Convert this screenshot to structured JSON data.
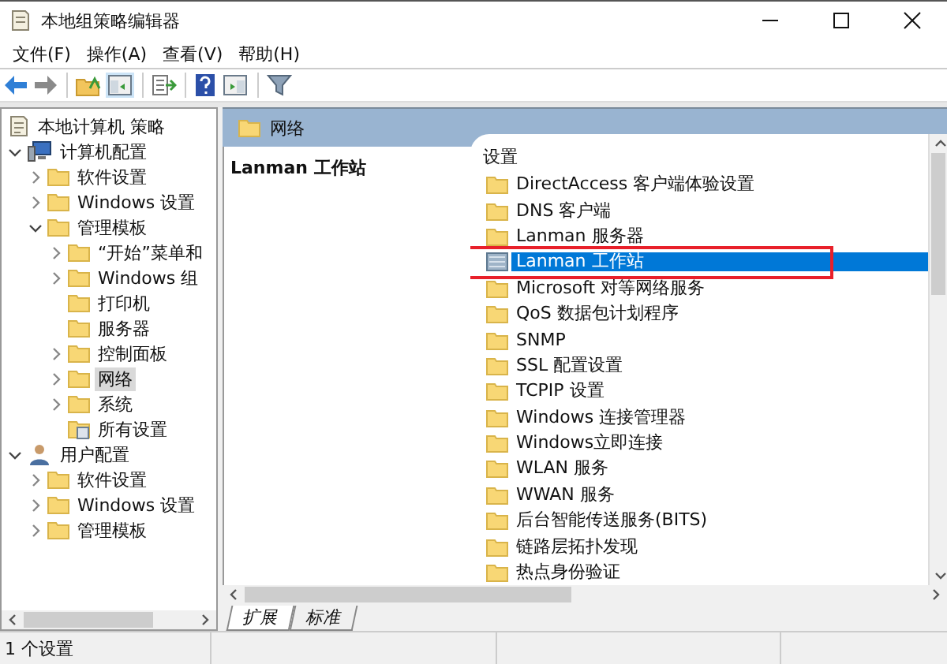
{
  "window": {
    "title": "本地组策略编辑器"
  },
  "menu": [
    "文件(F)",
    "操作(A)",
    "查看(V)",
    "帮助(H)"
  ],
  "tree": [
    {
      "label": "本地计算机 策略",
      "kind": "policy",
      "selected": false,
      "children": [
        {
          "label": "计算机配置",
          "kind": "computer",
          "selected": false,
          "expanded": true,
          "children": [
            {
              "label": "软件设置",
              "kind": "folder",
              "selected": false,
              "expanded": false
            },
            {
              "label": "Windows 设置",
              "kind": "folder",
              "selected": false,
              "expanded": false
            },
            {
              "label": "管理模板",
              "kind": "folder",
              "selected": false,
              "expanded": true,
              "children": [
                {
                  "label": "“开始”菜单和",
                  "kind": "folder",
                  "selected": false,
                  "expanded": false
                },
                {
                  "label": "Windows 组",
                  "kind": "folder",
                  "selected": false,
                  "expanded": false
                },
                {
                  "label": "打印机",
                  "kind": "folder",
                  "selected": false
                },
                {
                  "label": "服务器",
                  "kind": "folder",
                  "selected": false
                },
                {
                  "label": "控制面板",
                  "kind": "folder",
                  "selected": false,
                  "expanded": false
                },
                {
                  "label": "网络",
                  "kind": "folder",
                  "selected": true,
                  "expanded": false
                },
                {
                  "label": "系统",
                  "kind": "folder",
                  "selected": false,
                  "expanded": false
                },
                {
                  "label": "所有设置",
                  "kind": "allsettings",
                  "selected": false
                }
              ]
            }
          ]
        },
        {
          "label": "用户配置",
          "kind": "user",
          "selected": false,
          "expanded": true,
          "children": [
            {
              "label": "软件设置",
              "kind": "folder",
              "selected": false,
              "expanded": false
            },
            {
              "label": "Windows 设置",
              "kind": "folder",
              "selected": false,
              "expanded": false
            },
            {
              "label": "管理模板",
              "kind": "folder",
              "selected": false,
              "expanded": false
            }
          ]
        }
      ]
    }
  ],
  "pane_header": "网络",
  "description_title": "Lanman 工作站",
  "list_header": "设置",
  "items": [
    {
      "label": "DirectAccess 客户端体验设置",
      "kind": "folder",
      "selected": false
    },
    {
      "label": "DNS 客户端",
      "kind": "folder",
      "selected": false
    },
    {
      "label": "Lanman 服务器",
      "kind": "folder",
      "selected": false
    },
    {
      "label": "Lanman 工作站",
      "kind": "setting",
      "selected": true
    },
    {
      "label": "Microsoft 对等网络服务",
      "kind": "folder",
      "selected": false
    },
    {
      "label": "QoS 数据包计划程序",
      "kind": "folder",
      "selected": false
    },
    {
      "label": "SNMP",
      "kind": "folder",
      "selected": false
    },
    {
      "label": "SSL 配置设置",
      "kind": "folder",
      "selected": false
    },
    {
      "label": "TCPIP 设置",
      "kind": "folder",
      "selected": false
    },
    {
      "label": "Windows 连接管理器",
      "kind": "folder",
      "selected": false
    },
    {
      "label": "Windows立即连接",
      "kind": "folder",
      "selected": false
    },
    {
      "label": "WLAN 服务",
      "kind": "folder",
      "selected": false
    },
    {
      "label": "WWAN 服务",
      "kind": "folder",
      "selected": false
    },
    {
      "label": "后台智能传送服务(BITS)",
      "kind": "folder",
      "selected": false
    },
    {
      "label": "链路层拓扑发现",
      "kind": "folder",
      "selected": false
    },
    {
      "label": "热点身份验证",
      "kind": "folder",
      "selected": false
    }
  ],
  "tabs": [
    {
      "label": "扩展",
      "selected": true
    },
    {
      "label": "标准",
      "selected": false
    }
  ],
  "status_bar": "1 个设置"
}
